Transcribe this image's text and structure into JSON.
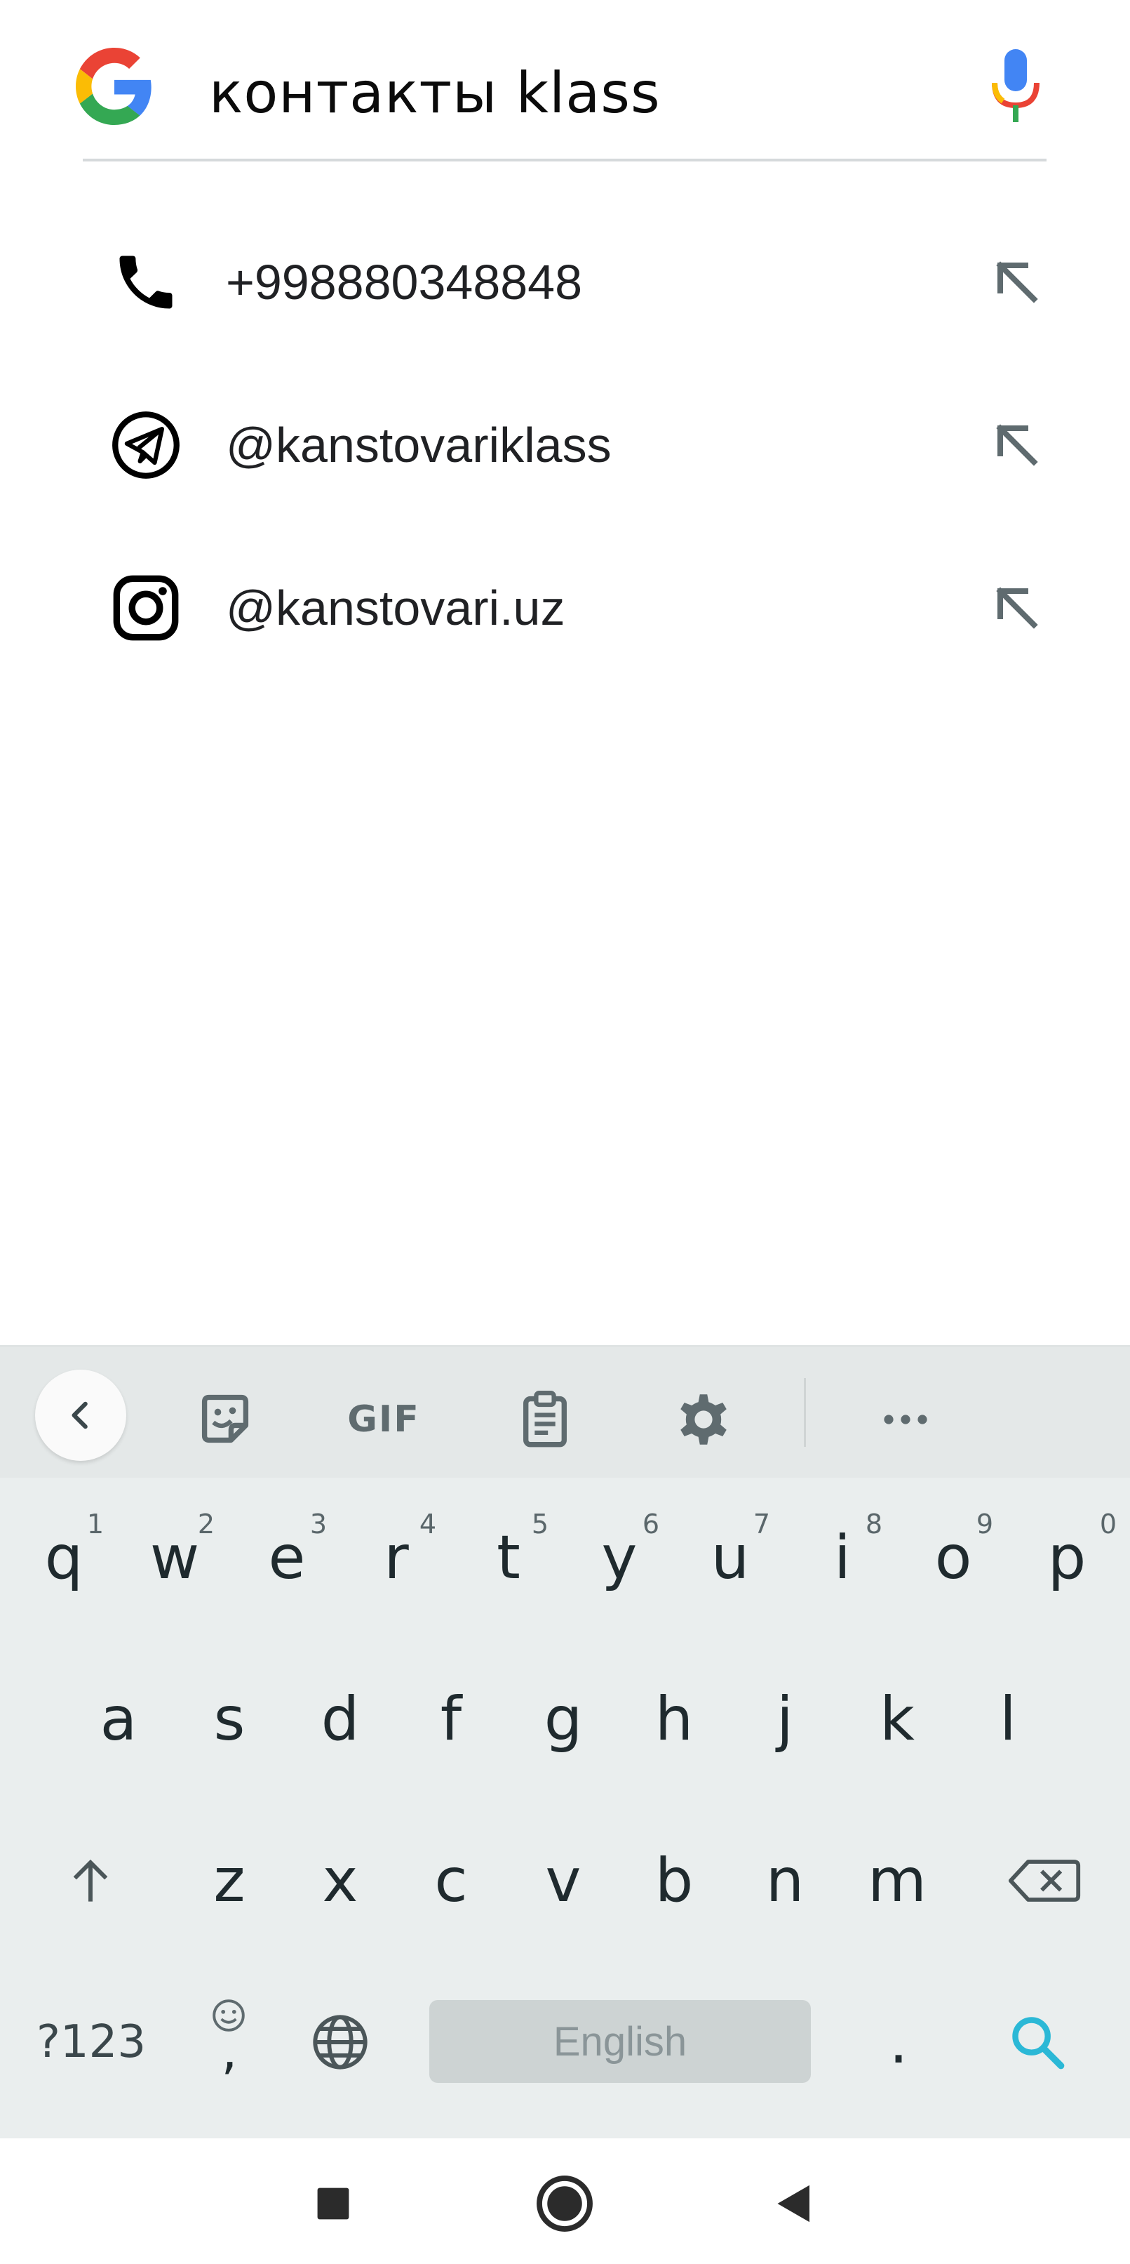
{
  "search": {
    "query": "контакты klass",
    "logo_icon": "google-g-icon",
    "mic_icon": "microphone-icon"
  },
  "suggestions": [
    {
      "icon": "phone-icon",
      "label": "+998880348848"
    },
    {
      "icon": "telegram-icon",
      "label": "@kanstovariklass"
    },
    {
      "icon": "instagram-icon",
      "label": "@kanstovari.uz"
    }
  ],
  "keyboard": {
    "toolbar": {
      "gif_label": "GIF",
      "items": [
        "back-icon",
        "sticker-icon",
        "gif",
        "clipboard-icon",
        "gear-icon",
        "more-icon"
      ]
    },
    "row1": [
      {
        "key": "q",
        "hint": "1"
      },
      {
        "key": "w",
        "hint": "2"
      },
      {
        "key": "e",
        "hint": "3"
      },
      {
        "key": "r",
        "hint": "4"
      },
      {
        "key": "t",
        "hint": "5"
      },
      {
        "key": "y",
        "hint": "6"
      },
      {
        "key": "u",
        "hint": "7"
      },
      {
        "key": "i",
        "hint": "8"
      },
      {
        "key": "o",
        "hint": "9"
      },
      {
        "key": "p",
        "hint": "0"
      }
    ],
    "row2": [
      "a",
      "s",
      "d",
      "f",
      "g",
      "h",
      "j",
      "k",
      "l"
    ],
    "row3": [
      "z",
      "x",
      "c",
      "v",
      "b",
      "n",
      "m"
    ],
    "symbols_label": "?123",
    "comma_label": ",",
    "period_label": ".",
    "space_label": "English"
  },
  "colors": {
    "google_blue": "#4285F4",
    "google_red": "#EA4335",
    "google_yellow": "#FBBC05",
    "google_green": "#34A853",
    "search_key": "#2bb8d6",
    "keyboard_bg": "#eaeeee"
  }
}
